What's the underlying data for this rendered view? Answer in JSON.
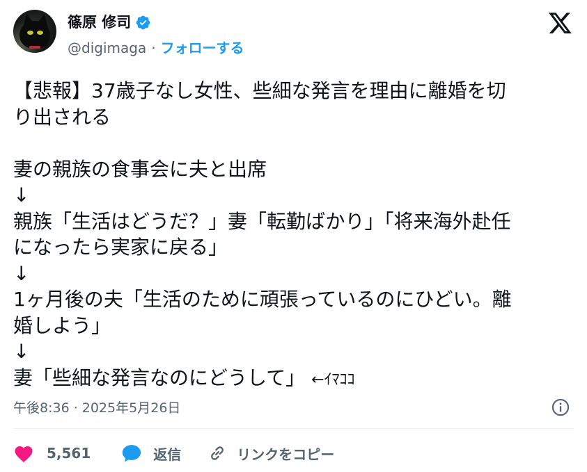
{
  "author": {
    "display_name": "篠原 修司",
    "handle": "@digimaga",
    "separator": "·",
    "follow_label": "フォローする",
    "verified_icon": "verified-badge-icon",
    "avatar": "black-cat-avatar"
  },
  "brand": {
    "logo": "x-logo-icon"
  },
  "tweet": {
    "lines": [
      "【悲報】37歳子なし女性、些細な発言を理由に離婚を切",
      "り出される",
      "",
      "妻の親族の食事会に夫と出席",
      "↓",
      "親族「生活はどうだ？」妻「転勤ばかり」「将来海外赴任",
      "になったら実家に戻る」",
      "↓",
      "1ヶ月後の夫「生活のために頑張っているのにひどい。離",
      "婚しよう」",
      "↓",
      "妻「些細な発言なのにどうして」"
    ],
    "trailing_tag": "←ｲﾏｺｺ",
    "timestamp": "午後8:36 · 2025年5月26日"
  },
  "actions": {
    "like_count": "5,561",
    "reply_label": "返信",
    "copy_link_label": "リンクをコピー"
  },
  "colors": {
    "text": "#0f1419",
    "secondary": "#536471",
    "accent": "#1d9bf0",
    "like": "#f91880",
    "divider": "#eff3f4"
  }
}
